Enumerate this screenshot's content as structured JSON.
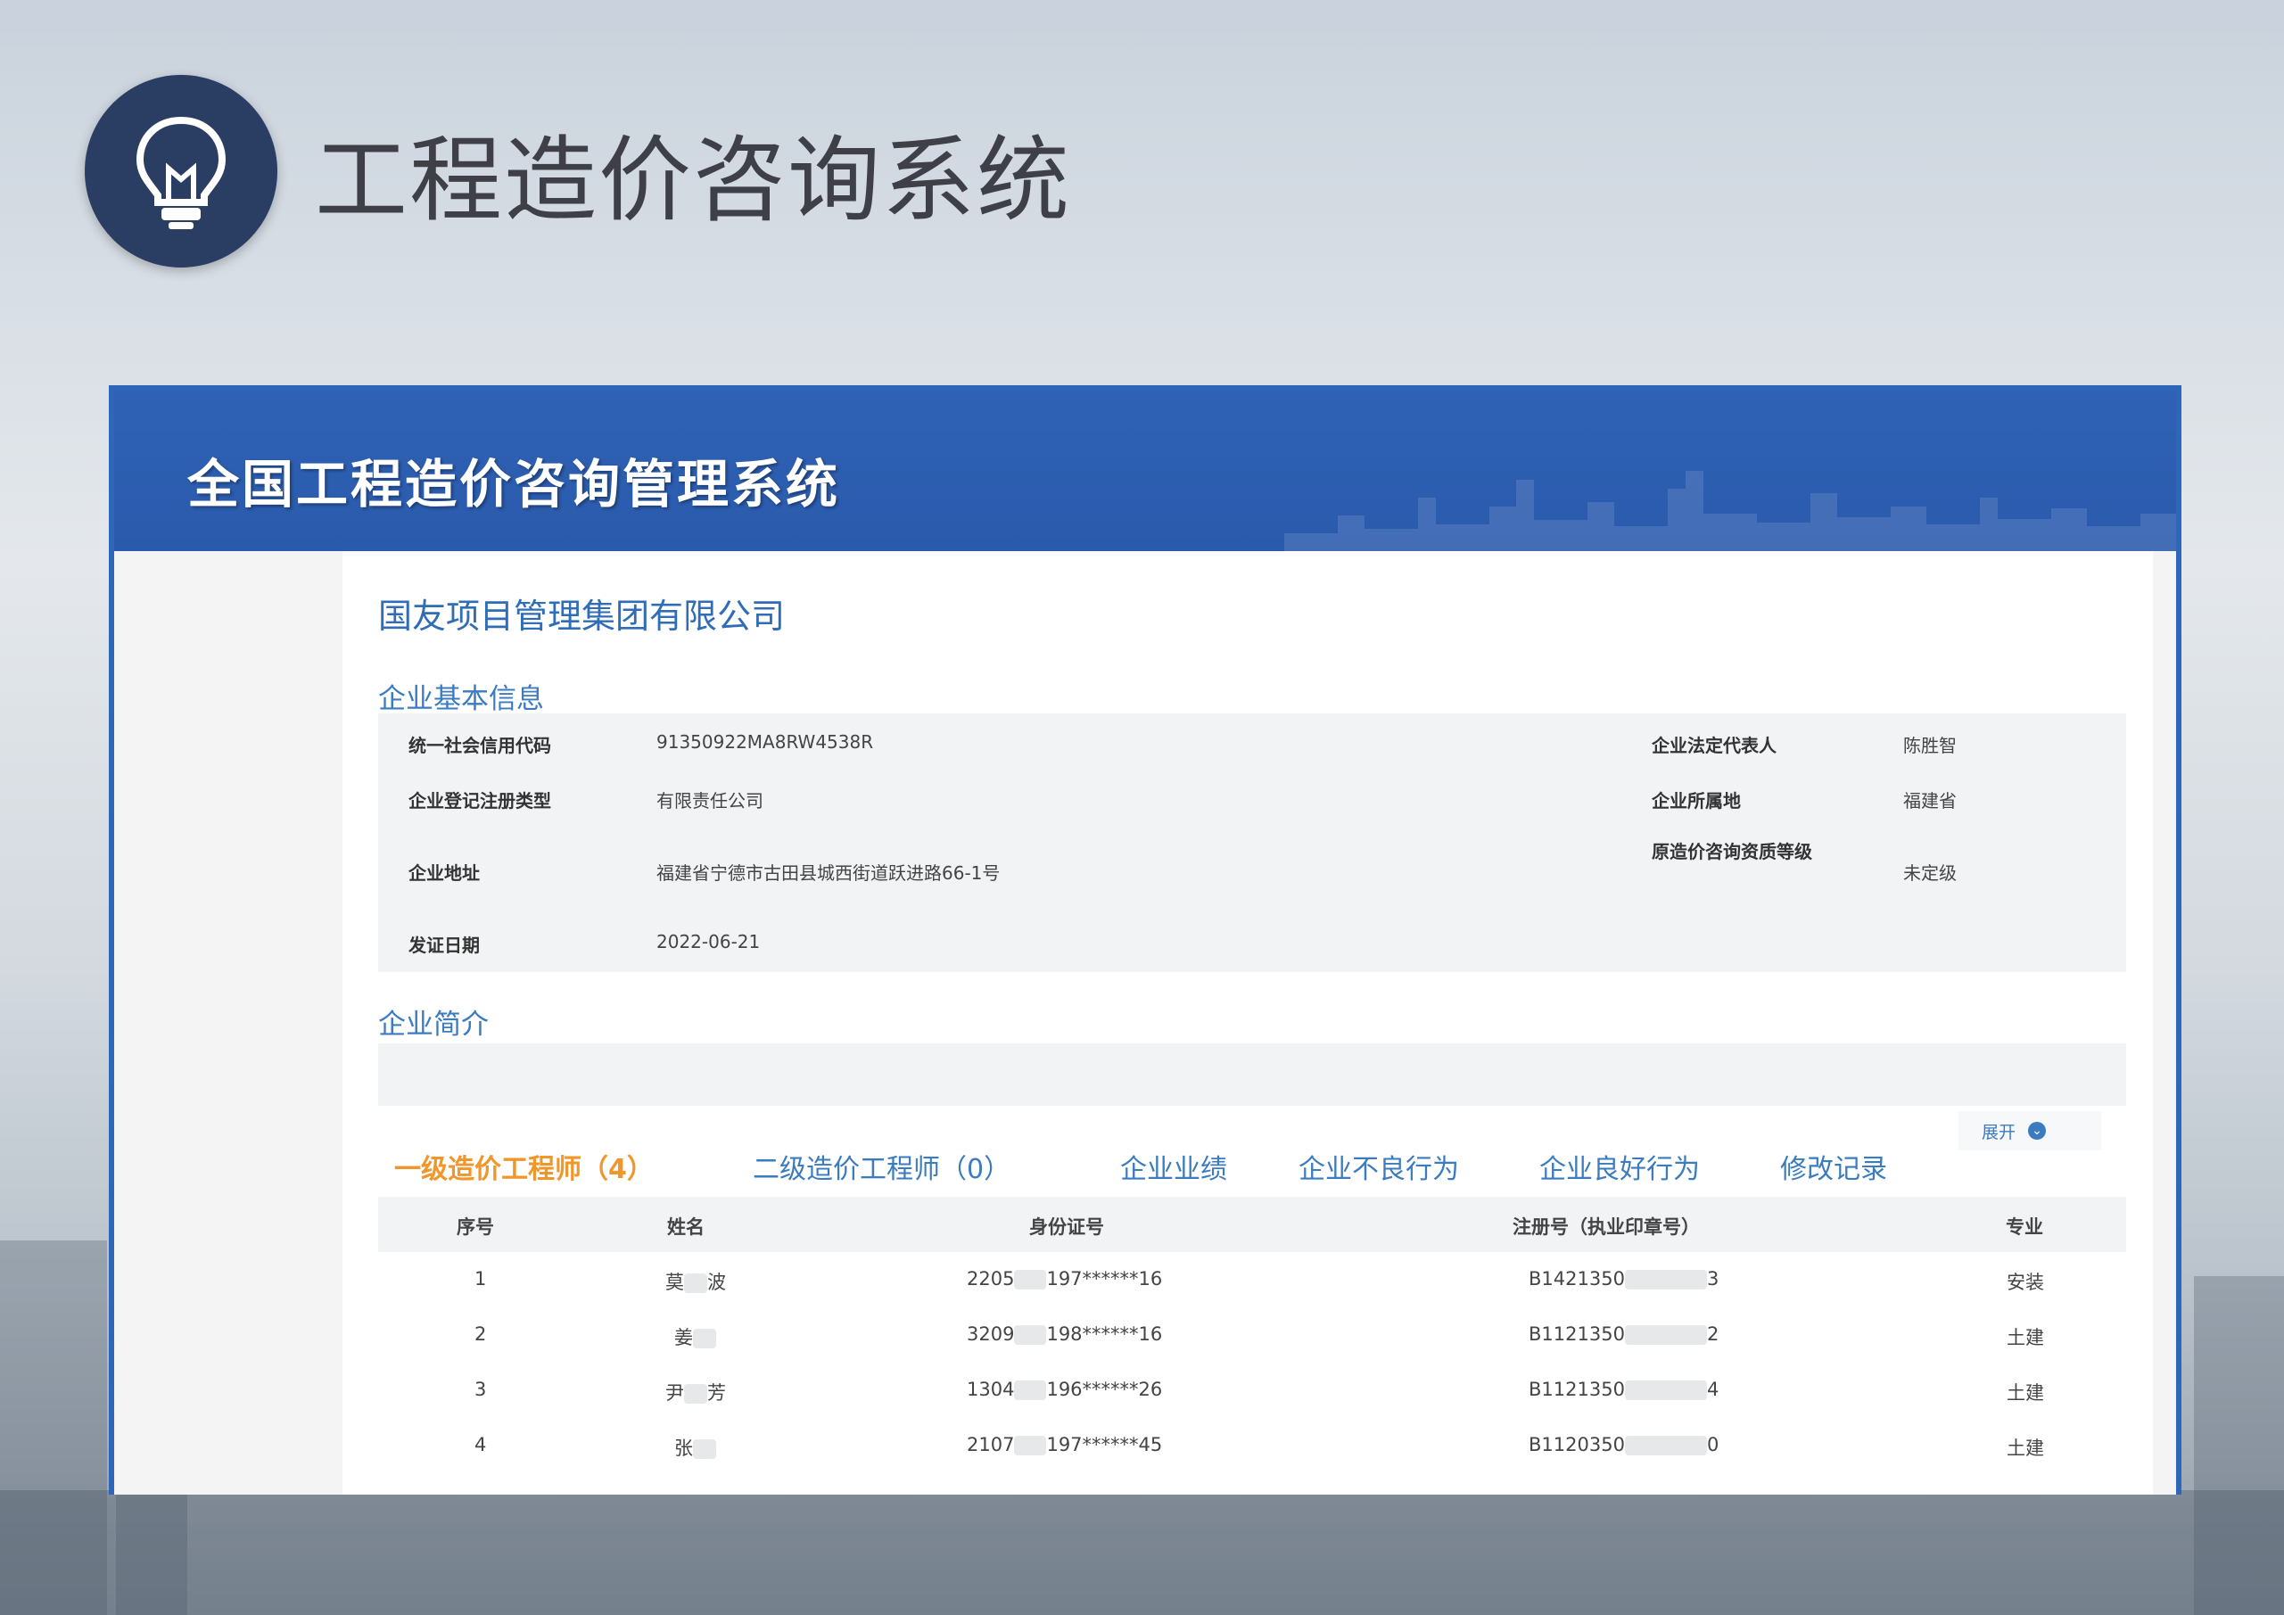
{
  "slide_title": "工程造价咨询系统",
  "frame": {
    "system_title": "全国工程造价咨询管理系统",
    "company_name": "国友项目管理集团有限公司",
    "basic_info_label": "企业基本信息",
    "basic_info": {
      "credit_code_key": "统一社会信用代码",
      "credit_code_val": "91350922MA8RW4538R",
      "legal_rep_key": "企业法定代表人",
      "legal_rep_val": "陈胜智",
      "reg_type_key": "企业登记注册类型",
      "reg_type_val": "有限责任公司",
      "location_key": "企业所属地",
      "location_val": "福建省",
      "address_key": "企业地址",
      "address_val": "福建省宁德市古田县城西街道跃进路66-1号",
      "qual_key": "原造价咨询资质等级",
      "qual_val": "未定级",
      "issue_date_key": "发证日期",
      "issue_date_val": "2022-06-21"
    },
    "intro_label": "企业简介",
    "expand_label": "展开",
    "tabs": [
      "一级造价工程师（4）",
      "二级造价工程师（0）",
      "企业业绩",
      "企业不良行为",
      "企业良好行为",
      "修改记录"
    ],
    "table": {
      "headers": [
        "序号",
        "姓名",
        "身份证号",
        "注册号（执业印章号）",
        "专业"
      ],
      "rows": [
        {
          "no": "1",
          "name_a": "莫",
          "name_b": "波",
          "id_a": "2205",
          "id_b": "197******16",
          "reg_a": "B1421350",
          "reg_b": "3",
          "major": "安装"
        },
        {
          "no": "2",
          "name_a": "姜",
          "name_b": "",
          "id_a": "3209",
          "id_b": "198******16",
          "reg_a": "B1121350",
          "reg_b": "2",
          "major": "土建"
        },
        {
          "no": "3",
          "name_a": "尹",
          "name_b": "芳",
          "id_a": "1304",
          "id_b": "196******26",
          "reg_a": "B1121350",
          "reg_b": "4",
          "major": "土建"
        },
        {
          "no": "4",
          "name_a": "张",
          "name_b": "",
          "id_a": "2107",
          "id_b": "197******45",
          "reg_a": "B1120350",
          "reg_b": "0",
          "major": "土建"
        }
      ]
    }
  },
  "colors": {
    "banner": "#2f62b5",
    "bulb_circle": "#2a3d63",
    "accent_tab": "#f0962a",
    "link_blue": "#3b7bc0"
  },
  "icons": {
    "bulb": "lightbulb-icon",
    "expand": "chevron-down-icon"
  }
}
